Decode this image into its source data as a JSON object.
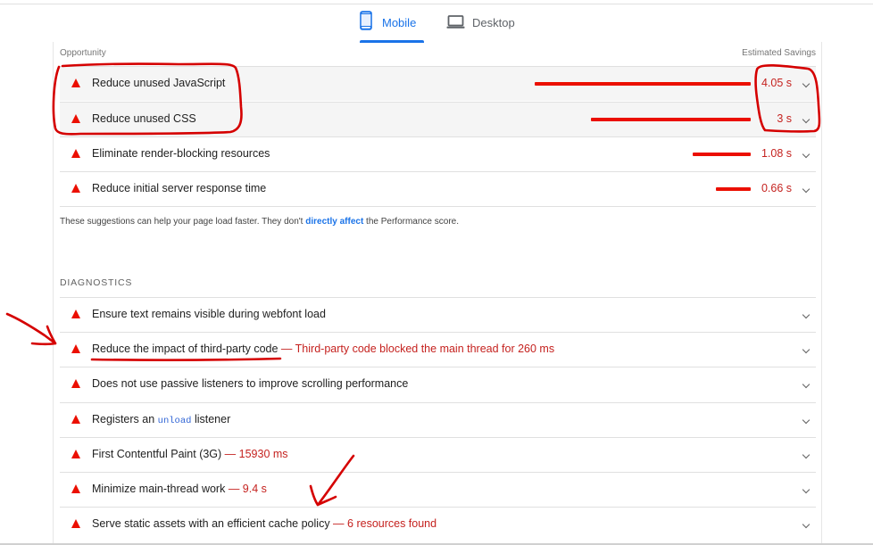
{
  "tabs": {
    "mobile": {
      "label": "Mobile",
      "icon": "smartphone-icon",
      "active": true
    },
    "desktop": {
      "label": "Desktop",
      "icon": "laptop-icon",
      "active": false
    }
  },
  "opportunity": {
    "header_left": "Opportunity",
    "header_right": "Estimated Savings",
    "items": [
      {
        "title": "Reduce unused JavaScript",
        "savings": "4.05 s",
        "bar_fraction": 1.0
      },
      {
        "title": "Reduce unused CSS",
        "savings": "3 s",
        "bar_fraction": 0.74
      },
      {
        "title": "Eliminate render-blocking resources",
        "savings": "1.08 s",
        "bar_fraction": 0.27
      },
      {
        "title": "Reduce initial server response time",
        "savings": "0.66 s",
        "bar_fraction": 0.16
      }
    ],
    "note_before": "These suggestions can help your page load faster. They don't ",
    "note_link": "directly affect",
    "note_after": " the Performance score."
  },
  "diagnostics": {
    "title": "DIAGNOSTICS",
    "items": [
      {
        "title": "Ensure text remains visible during webfont load",
        "detail": ""
      },
      {
        "title": "Reduce the impact of third-party code",
        "detail": " — Third-party code blocked the main thread for 260 ms"
      },
      {
        "title": "Does not use passive listeners to improve scrolling performance",
        "detail": ""
      },
      {
        "title_before": "Registers an ",
        "code": "unload",
        "title_after": " listener",
        "detail": ""
      },
      {
        "title": "First Contentful Paint (3G)",
        "detail": " — 15930 ms"
      },
      {
        "title": "Minimize main-thread work",
        "detail": " — 9.4 s"
      },
      {
        "title": "Serve static assets with an efficient cache policy",
        "detail": " — 6 resources found"
      }
    ]
  },
  "colors": {
    "accent": "#1a73e8",
    "fail": "#eb0f00",
    "annotation": "#d50000"
  }
}
